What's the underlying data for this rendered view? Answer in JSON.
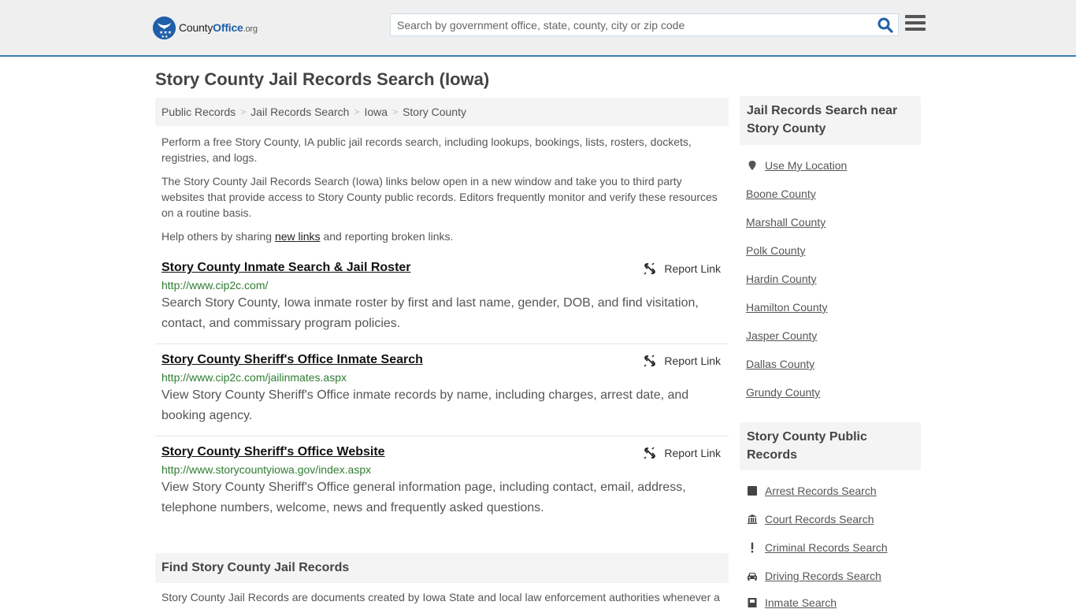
{
  "header": {
    "logo": {
      "county": "County",
      "office": "Office",
      "org": ".org"
    },
    "search": {
      "placeholder": "Search by government office, state, county, city or zip code",
      "value": ""
    },
    "brand_color": "#1f5fa8",
    "accent_border_color": "#3a7fb5"
  },
  "page": {
    "title": "Story County Jail Records Search (Iowa)",
    "breadcrumb": [
      "Public Records",
      "Jail Records Search",
      "Iowa",
      "Story County"
    ],
    "intro": {
      "p1": "Perform a free Story County, IA public jail records search, including lookups, bookings, lists, rosters, dockets, registries, and logs.",
      "p2": "The Story County Jail Records Search (Iowa) links below open in a new window and take you to third party websites that provide access to Story County public records. Editors frequently monitor and verify these resources on a routine basis.",
      "p3_before": "Help others by sharing ",
      "p3_link": "new links",
      "p3_after": " and reporting broken links."
    },
    "results": [
      {
        "title": "Story County Inmate Search & Jail Roster",
        "url": "http://www.cip2c.com/",
        "description": "Search Story County, Iowa inmate roster by first and last name, gender, DOB, and find visitation, contact, and commissary program policies.",
        "report_label": "Report Link"
      },
      {
        "title": "Story County Sheriff's Office Inmate Search",
        "url": "http://www.cip2c.com/jailinmates.aspx",
        "description": "View Story County Sheriff's Office inmate records by name, including charges, arrest date, and booking agency.",
        "report_label": "Report Link"
      },
      {
        "title": "Story County Sheriff's Office Website",
        "url": "http://www.storycountyiowa.gov/index.aspx",
        "description": "View Story County Sheriff's Office general information page, including contact, email, address, telephone numbers, welcome, news and frequently asked questions.",
        "report_label": "Report Link"
      }
    ],
    "find_section": {
      "heading": "Find Story County Jail Records",
      "text": "Story County Jail Records are documents created by Iowa State and local law enforcement authorities whenever a"
    }
  },
  "sidebar": {
    "nearby": {
      "heading": "Jail Records Search near Story County",
      "use_location": "Use My Location",
      "counties": [
        "Boone County",
        "Marshall County",
        "Polk County",
        "Hardin County",
        "Hamilton County",
        "Jasper County",
        "Dallas County",
        "Grundy County"
      ]
    },
    "public_records": {
      "heading": "Story County Public Records",
      "items": [
        {
          "label": "Arrest Records Search",
          "icon": "square-icon"
        },
        {
          "label": "Court Records Search",
          "icon": "courthouse-icon"
        },
        {
          "label": "Criminal Records Search",
          "icon": "exclamation-icon"
        },
        {
          "label": "Driving Records Search",
          "icon": "car-icon"
        },
        {
          "label": "Inmate Search",
          "icon": "inmate-icon"
        }
      ]
    }
  }
}
